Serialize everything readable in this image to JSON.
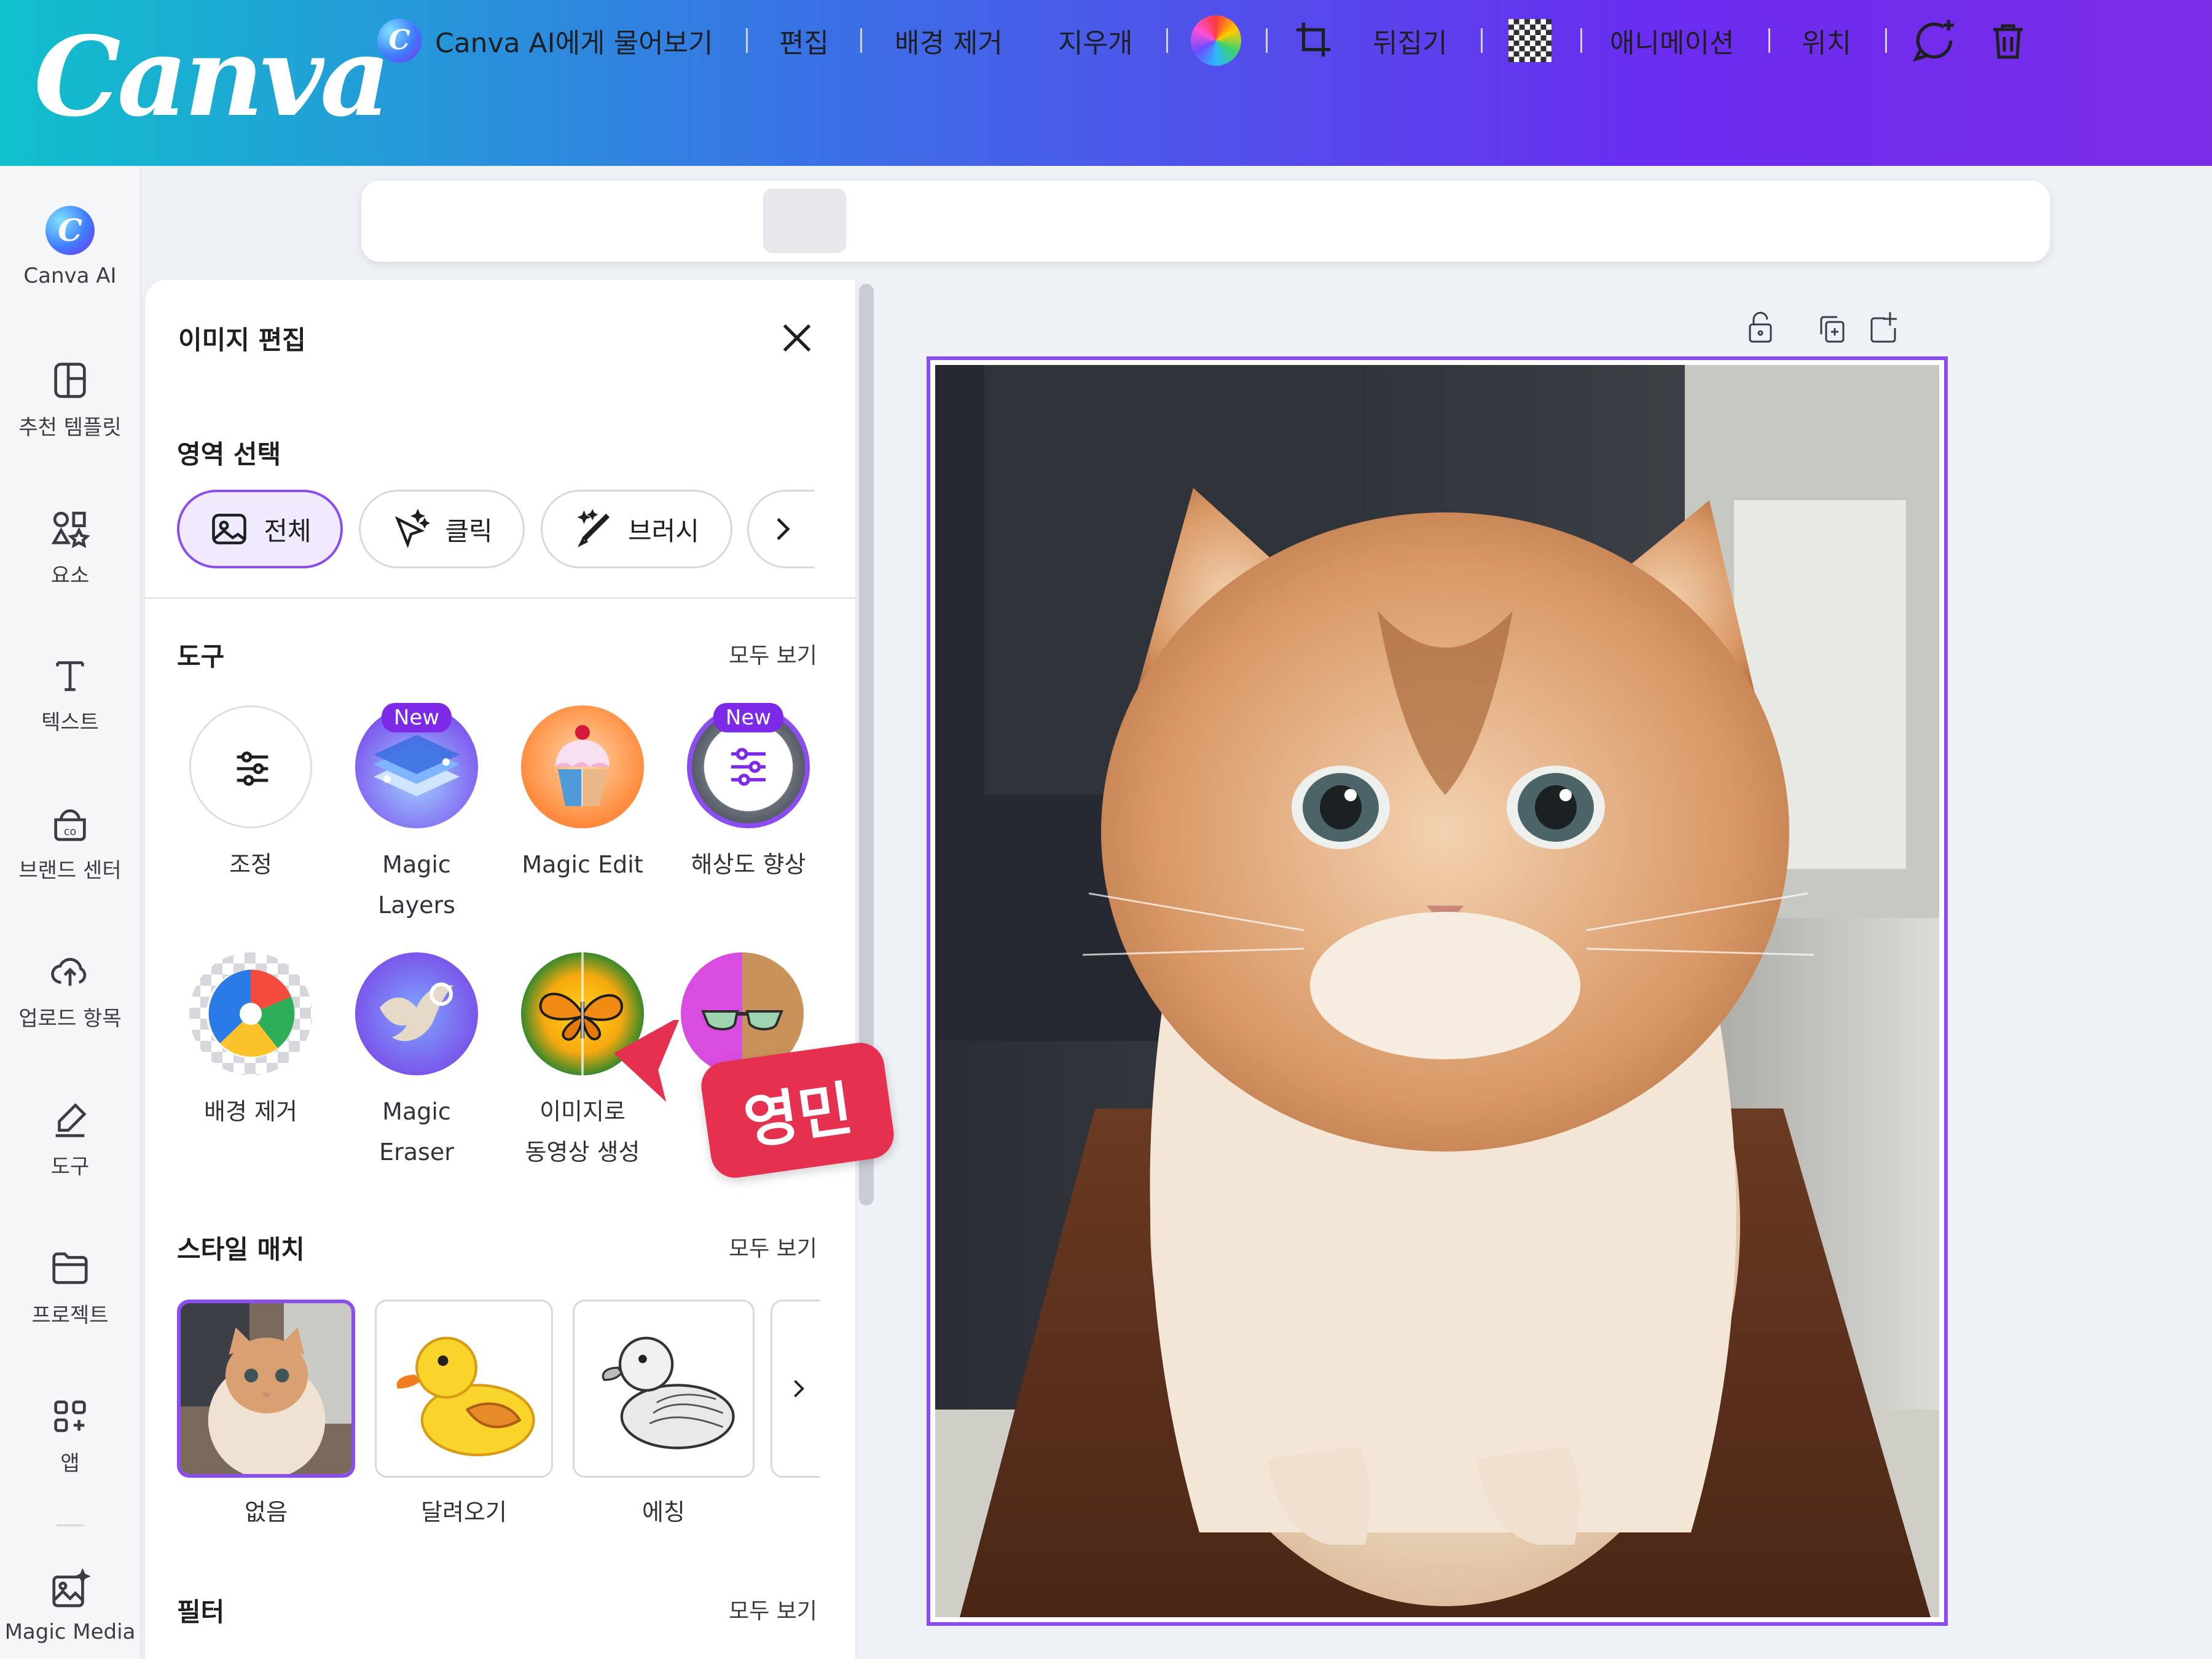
{
  "brand": {
    "logo_text": "Canva"
  },
  "toolbar": {
    "ask_ai": "Canva AI에게 물어보기",
    "edit": "편집",
    "bg_remove": "배경 제거",
    "eraser": "지우개",
    "flip": "뒤집기",
    "animate": "애니메이션",
    "position": "위치"
  },
  "rail": {
    "canva_ai": "Canva AI",
    "templates": "추천 템플릿",
    "elements": "요소",
    "text": "텍스트",
    "brand": "브랜드 센터",
    "uploads": "업로드 항목",
    "tools": "도구",
    "projects": "프로젝트",
    "apps": "앱",
    "magic_media": "Magic Media"
  },
  "panel": {
    "title": "이미지 편집",
    "area_select": "영역 선택",
    "area_options": [
      "전체",
      "클릭",
      "브러시"
    ],
    "tools_title": "도구",
    "see_all": "모두 보기",
    "new_badge": "New",
    "tools": [
      {
        "line1": "조정",
        "line2": ""
      },
      {
        "line1": "Magic",
        "line2": "Layers"
      },
      {
        "line1": "Magic Edit",
        "line2": ""
      },
      {
        "line1": "해상도 향상",
        "line2": ""
      },
      {
        "line1": "배경 제거",
        "line2": ""
      },
      {
        "line1": "Magic",
        "line2": "Eraser"
      },
      {
        "line1": "이미지로",
        "line2": "동영상 생성"
      }
    ],
    "style_match_title": "스타일 매치",
    "styles": [
      "없음",
      "달려오기",
      "에칭"
    ],
    "filter_title": "필터"
  },
  "annotation": {
    "tag": "영민"
  },
  "colors": {
    "accent": "#8b4df0",
    "header_start": "#10c0cc",
    "header_end": "#7b2de6",
    "tag": "#e5304f"
  }
}
